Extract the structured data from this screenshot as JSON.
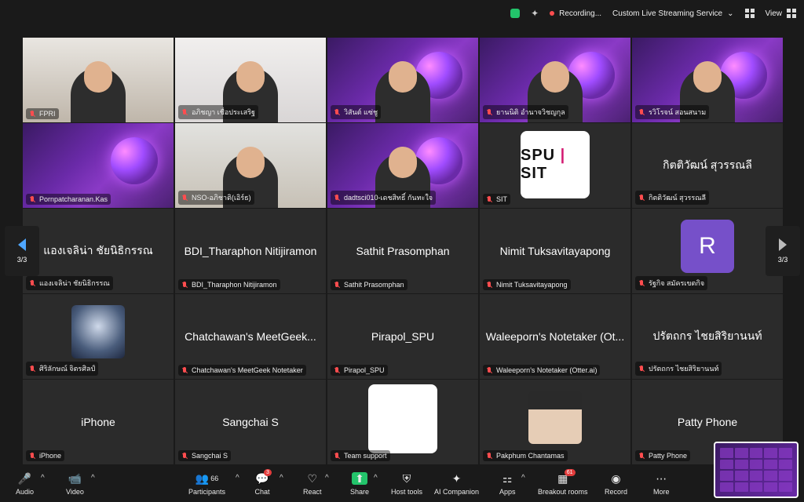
{
  "topbar": {
    "recording": "Recording...",
    "stream": "Custom Live Streaming Service",
    "view": "View"
  },
  "nav": {
    "left_page": "3/3",
    "right_page": "3/3"
  },
  "tiles": [
    {
      "label": "FPRI",
      "type": "video",
      "variant": "video-warm"
    },
    {
      "label": "อภิชญา เชื่อประเสริฐ",
      "type": "video",
      "variant": "video-light"
    },
    {
      "label": "วิสันต์ แซ่ชู",
      "type": "stage"
    },
    {
      "label": "ยานนิติ อำนาจวิชญกุล",
      "type": "stage"
    },
    {
      "label": "รวิโรจน์ สอนสนาม",
      "type": "stage"
    },
    {
      "label": "Pornpatcharanan.Kas",
      "type": "stage_only"
    },
    {
      "label": "NSO-อภิชาติ(เอิร์ธ)",
      "type": "video",
      "variant": "video-room"
    },
    {
      "label": "dadtsci010-เดชสิทธิ์ กันทะใจ",
      "type": "stage"
    },
    {
      "label": "SIT",
      "type": "logo"
    },
    {
      "label": "กิตติวัฒน์ สุวรรณลี",
      "type": "name",
      "center": "กิตติวัฒน์ สุวรรณลี"
    },
    {
      "label": "แองเจลิน่า ชัยนิธิกรรณ",
      "type": "name",
      "center": "แองเจลิน่า ชัยนิธิกรรณ"
    },
    {
      "label": "BDI_Tharaphon Nitijiramon",
      "type": "name",
      "center": "BDI_Tharaphon Nitijiramon"
    },
    {
      "label": "Sathit Prasomphan",
      "type": "name",
      "center": "Sathit Prasomphan"
    },
    {
      "label": "Nimit Tuksavitayapong",
      "type": "name",
      "center": "Nimit Tuksavitayapong"
    },
    {
      "label": "รัฐกิจ สมัครเขตกิจ",
      "type": "avatar",
      "letter": "R"
    },
    {
      "label": "ศิริลักษณ์ จิตรศิลป์",
      "type": "concert"
    },
    {
      "label": "Chatchawan's MeetGeek Notetaker",
      "type": "name",
      "center": "Chatchawan's MeetGeek..."
    },
    {
      "label": "Pirapol_SPU",
      "type": "name",
      "center": "Pirapol_SPU"
    },
    {
      "label": "Waleeporn's Notetaker (Otter.ai)",
      "type": "name",
      "center": "Waleeporn's Notetaker (Ot..."
    },
    {
      "label": "ปรัตถกร ไชยสิริยานนท์",
      "type": "name",
      "center": "ปรัตถกร ไชยสิริยานนท์"
    },
    {
      "label": "iPhone",
      "type": "name",
      "center": "iPhone"
    },
    {
      "label": "Sangchai S",
      "type": "name",
      "center": "Sangchai S"
    },
    {
      "label": "Team support",
      "type": "white"
    },
    {
      "label": "Pakphum Chantamas",
      "type": "pakphum"
    },
    {
      "label": "Patty Phone",
      "type": "name",
      "center": "Patty Phone"
    }
  ],
  "sit_logo": {
    "left": "SPU",
    "right": "SIT"
  },
  "toolbar": {
    "audio": "Audio",
    "video": "Video",
    "participants": "Participants",
    "participants_count": "66",
    "chat": "Chat",
    "chat_badge": "3",
    "react": "React",
    "share": "Share",
    "host_tools": "Host tools",
    "ai_companion": "AI Companion",
    "apps": "Apps",
    "breakout": "Breakout rooms",
    "breakout_badge": "61",
    "record": "Record",
    "more": "More"
  },
  "colors": {
    "accent": "#4ea6ff",
    "muted": "#ff4d4f",
    "share": "#23c46b",
    "avatar": "#7650c9"
  }
}
